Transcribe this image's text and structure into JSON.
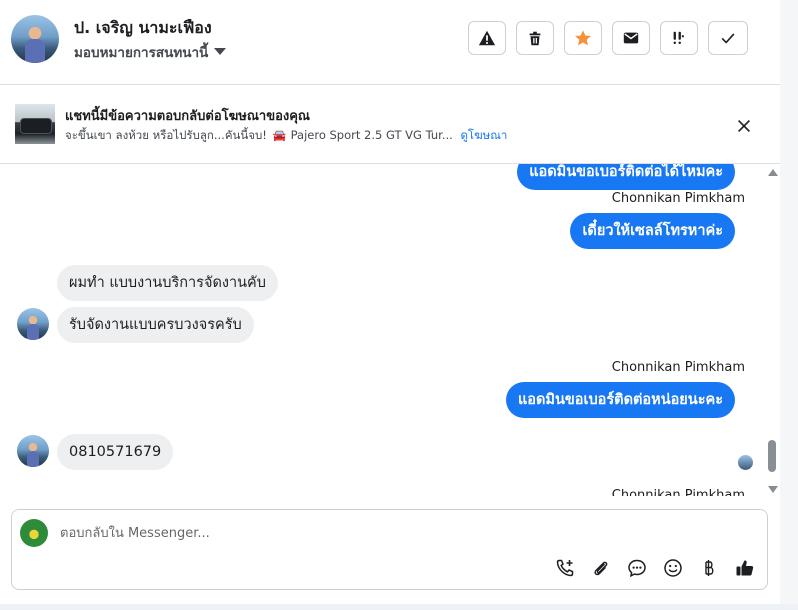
{
  "header": {
    "contact_name": "ป. เจริญ นามะเฟือง",
    "assign_label": "มอบหมายการสนทนานี้",
    "action_icons": [
      "warning-icon",
      "trash-icon",
      "star-icon",
      "envelope-icon",
      "exclamation-double-icon",
      "checkmark-icon"
    ],
    "star_color": "#f7923a"
  },
  "ad": {
    "title": "แชทนี้มีข้อความตอบกลับต่อโฆษณาของคุณ",
    "description": "จะขึ้นเขา ลงห้วย หรือไปรับลูก...คันนี้จบ!",
    "car_text": "Pajero Sport 2.5 GT VG Tur...",
    "view_ad_link": "ดูโฆษณา"
  },
  "messages": [
    {
      "direction": "out",
      "text": "แอดมินขอเบอร์ติดต่อได้ไหมคะ"
    },
    {
      "direction": "meta",
      "text": "Chonnikan Pimkham"
    },
    {
      "direction": "out",
      "text": "เดี๋ยวให้เซลล์โทรหาค่ะ"
    },
    {
      "direction": "in",
      "text": "ผมทำ แบบงานบริการจัดงานคับ"
    },
    {
      "direction": "in",
      "text": "รับจัดงานแบบครบวงจรครับ"
    },
    {
      "direction": "meta",
      "text": "Chonnikan Pimkham"
    },
    {
      "direction": "out",
      "text": "แอดมินขอเบอร์ติดต่อหน่อยนะคะ"
    },
    {
      "direction": "in",
      "text": "0810571679"
    },
    {
      "direction": "meta",
      "text": "Chonnikan Pimkham"
    }
  ],
  "composer": {
    "placeholder": "ตอบกลับใน Messenger...",
    "icons": [
      "phone-add-icon",
      "paperclip-icon",
      "chat-bubble-icon",
      "emoji-icon",
      "baht-icon",
      "thumbs-up-icon"
    ]
  },
  "colors": {
    "outgoing_bubble": "#1877f2",
    "incoming_bubble": "#eeeff1",
    "link": "#1877f2"
  }
}
